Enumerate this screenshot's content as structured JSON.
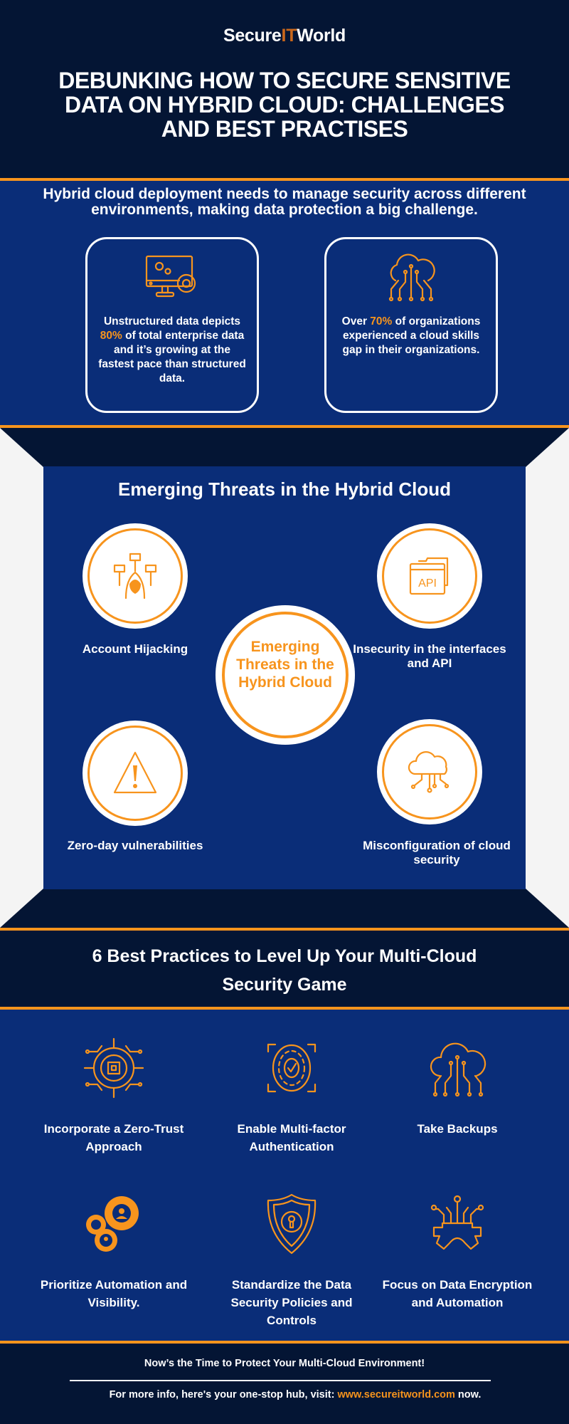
{
  "header": {
    "logo": {
      "part1": "Secure",
      "part2": "IT",
      "part3": "World"
    },
    "title": "DEBUNKING HOW TO SECURE SENSITIVE DATA ON HYBRID CLOUD: CHALLENGES AND BEST PRACTISES"
  },
  "stats": {
    "intro": "Hybrid cloud deployment needs to manage security across different environments, making data protection a big challenge.",
    "cards": [
      {
        "icon": "monitor-gears-icon",
        "pre": "Unstructured data depicts ",
        "highlight": "80%",
        "post": " of total enterprise data and it’s growing at the fastest pace than structured data."
      },
      {
        "icon": "cloud-network-icon",
        "pre": "Over ",
        "highlight": "70%",
        "post": " of organizations experienced a cloud skills gap in their organizations."
      }
    ]
  },
  "threats": {
    "title": "Emerging Threats in the Hybrid Cloud",
    "center": "Emerging Threats in the Hybrid Cloud",
    "items": [
      {
        "icon": "hacker-icon",
        "label": "Account Hijacking"
      },
      {
        "icon": "api-icon",
        "label": "Insecurity in the interfaces and API"
      },
      {
        "icon": "warning-icon",
        "label": "Zero-day vulnerabilities"
      },
      {
        "icon": "cloud-config-icon",
        "label": "Misconfiguration of cloud security"
      }
    ]
  },
  "best_practices": {
    "title": "6 Best Practices to Level Up Your Multi-Cloud Security Game",
    "items": [
      {
        "icon": "chip-gear-icon",
        "label": "Incorporate a Zero-Trust Approach"
      },
      {
        "icon": "face-check-icon",
        "label": "Enable Multi-factor Authentication"
      },
      {
        "icon": "cloud-backup-icon",
        "label": "Take Backups"
      },
      {
        "icon": "gears-people-icon",
        "label": "Prioritize Automation and Visibility."
      },
      {
        "icon": "shield-lock-icon",
        "label": "Standardize the Data Security Policies and Controls"
      },
      {
        "icon": "gear-circuit-icon",
        "label": "Focus on Data Encryption and Automation"
      }
    ]
  },
  "footer": {
    "cta": "Now’s the Time to Protect Your Multi-Cloud Environment!",
    "info_pre": "For more info, here's your one-stop hub, visit: ",
    "link": "www.secureitworld.com",
    "info_post": " now."
  },
  "colors": {
    "navy": "#041534",
    "blue": "#0a2d78",
    "orange": "#f7941d",
    "white": "#ffffff"
  }
}
